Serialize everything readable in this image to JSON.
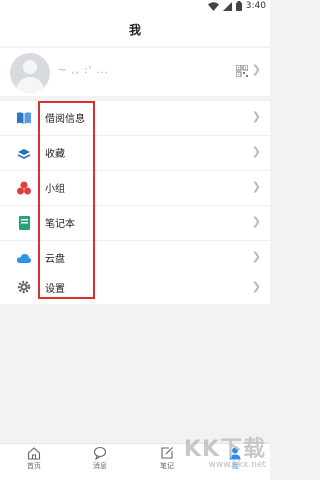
{
  "status_bar": {
    "time": "3:40"
  },
  "header": {
    "title": "我"
  },
  "profile": {
    "username": "~ ,, :' ..."
  },
  "menu": {
    "items": [
      {
        "label": "借阅信息",
        "icon": "book-icon",
        "color": "#2f78c9"
      },
      {
        "label": "收藏",
        "icon": "layers-icon",
        "color": "#2b6fb3"
      },
      {
        "label": "小组",
        "icon": "group-icon",
        "color": "#e0403d"
      },
      {
        "label": "笔记本",
        "icon": "notebook-icon",
        "color": "#22a37d"
      },
      {
        "label": "云盘",
        "icon": "cloud-icon",
        "color": "#2f95e6"
      }
    ],
    "settings_label": "设置"
  },
  "tab_bar": {
    "tabs": [
      {
        "label": "首页",
        "icon": "home-icon"
      },
      {
        "label": "消息",
        "icon": "chat-icon"
      },
      {
        "label": "笔记",
        "icon": "note-edit-icon"
      },
      {
        "label": "我",
        "icon": "user-icon",
        "active": true
      }
    ]
  },
  "watermark": {
    "main": "KK下载",
    "sub": "www.kkx.net"
  },
  "colors": {
    "accent": "#2a8ef0",
    "annotation": "#d8312e"
  }
}
